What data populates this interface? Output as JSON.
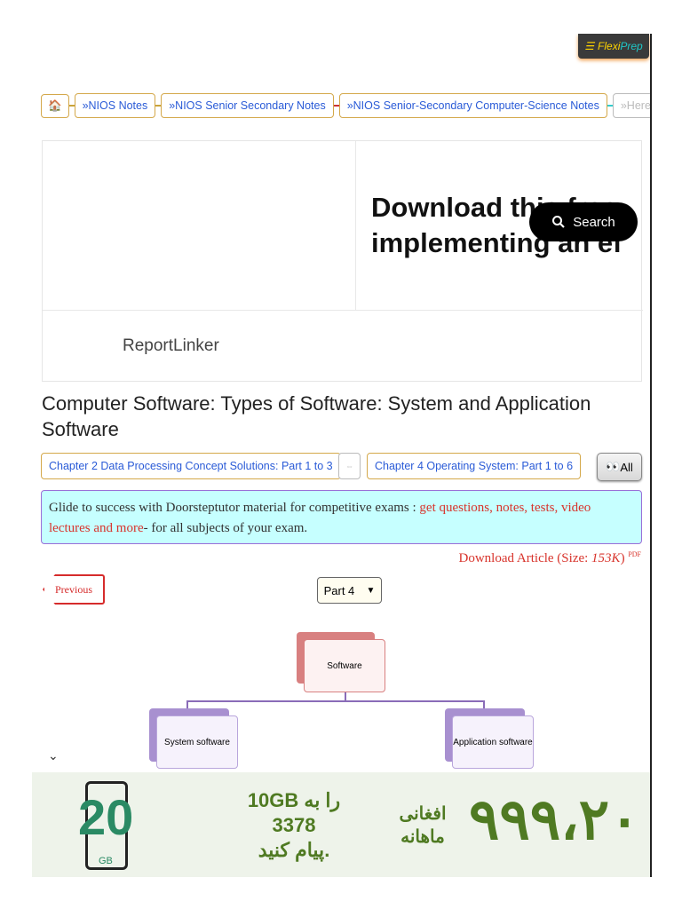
{
  "logo": {
    "menu_icon": "☰",
    "text_a": "Flexi",
    "text_b": "Prep"
  },
  "breadcrumbs": [
    {
      "label": "»NIOS Notes"
    },
    {
      "label": "»NIOS Senior Secondary Notes"
    },
    {
      "label": "»NIOS Senior-Secondary Computer-Science Notes"
    },
    {
      "label": "»Here"
    }
  ],
  "ad": {
    "headline_1": "Download this free",
    "headline_2": "implementing an ef",
    "brand": "ReportLinker"
  },
  "search_button": "Search",
  "title": "Computer Software: Types of Software: System and Application Software",
  "nav": {
    "prev_chapter": "Chapter 2 Data Processing Concept Solutions: Part 1 to 3",
    "sep": "⇔",
    "next_chapter": "Chapter 4 Operating System: Part 1 to 6",
    "all": "All"
  },
  "promo": {
    "text1": "Glide to success with Doorsteptutor material for competitive exams : ",
    "link": "get questions, notes, tests, video lectures and more",
    "text2": "- for all subjects of your exam."
  },
  "download": {
    "label": "Download Article (Size: ",
    "size": "153K",
    ")": ")",
    "close": ")",
    "pdf": "PDF"
  },
  "previous": "Previous",
  "part_select": "Part 4",
  "diagram": {
    "root": "Software",
    "left": "System software",
    "right": "Application software"
  },
  "banner": {
    "big": "20",
    "gb": "GB",
    "mid1": "10GB را به",
    "mid2": "3378",
    "mid3": "پیام کنید.",
    "unit1": "افغانی",
    "unit2": "ماهانه",
    "price": "۹۹۹،۲۰"
  },
  "colors": {
    "accent": "#2a5bd7",
    "red": "#d8342c",
    "promo_bg": "#c6ffff",
    "banner_green": "#4f7a22"
  }
}
